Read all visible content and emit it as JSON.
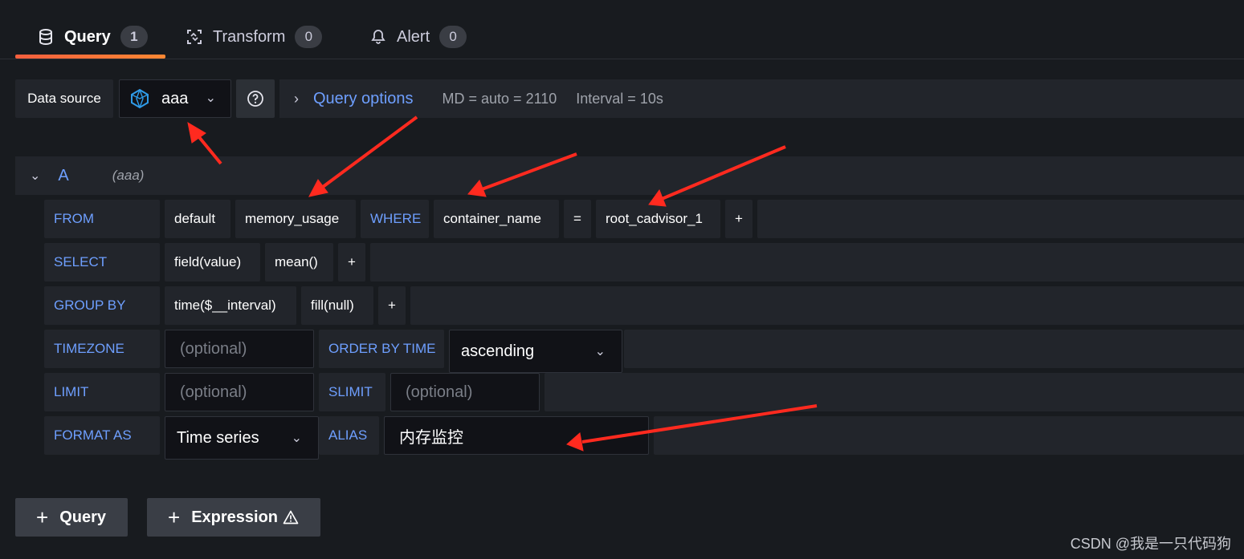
{
  "tabs": [
    {
      "label": "Query",
      "count": "1",
      "icon": "database-icon"
    },
    {
      "label": "Transform",
      "count": "0",
      "icon": "transform-icon"
    },
    {
      "label": "Alert",
      "count": "0",
      "icon": "bell-icon"
    }
  ],
  "datasource": {
    "label": "Data source",
    "selected": "aaa",
    "icon": "influxdb-icon"
  },
  "query_options": {
    "title": "Query options",
    "md": "MD = auto = 2110",
    "interval": "Interval = 10s"
  },
  "query": {
    "ref_id": "A",
    "ds_name": "(aaa)",
    "from": {
      "keyword": "FROM",
      "policy": "default",
      "measurement": "memory_usage",
      "where_keyword": "WHERE",
      "tag_key": "container_name",
      "operator": "=",
      "tag_value": "root_cadvisor_1",
      "plus": "+"
    },
    "select": {
      "keyword": "SELECT",
      "field": "field(value)",
      "func": "mean()",
      "plus": "+"
    },
    "group_by": {
      "keyword": "GROUP BY",
      "time": "time($__interval)",
      "fill": "fill(null)",
      "plus": "+"
    },
    "timezone": {
      "keyword": "TIMEZONE",
      "placeholder": "(optional)",
      "order_keyword": "ORDER BY TIME",
      "order_value": "ascending"
    },
    "limit": {
      "keyword": "LIMIT",
      "placeholder": "(optional)",
      "slimit_keyword": "SLIMIT",
      "slimit_placeholder": "(optional)"
    },
    "format": {
      "keyword": "FORMAT AS",
      "value": "Time series",
      "alias_keyword": "ALIAS",
      "alias_value": "内存监控"
    }
  },
  "buttons": {
    "add_query": "Query",
    "add_expression": "Expression"
  },
  "watermark": "CSDN @我是一只代码狗",
  "colors": {
    "accent_blue": "#6e9fff",
    "tab_underline": "#ff7733",
    "arrow": "#ff2a1f"
  }
}
